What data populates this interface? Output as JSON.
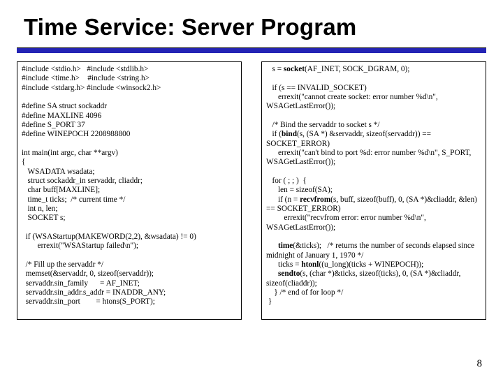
{
  "title": "Time Service: Server Program",
  "page_number": "8",
  "left": {
    "l1": "#include <stdio.h>   #include <stdlib.h>",
    "l2": "#include <time.h>    #include <string.h>",
    "l3": "#include <stdarg.h> #include <winsock2.h>",
    "l4": "",
    "l5": "#define SA struct sockaddr",
    "l6": "#define MAXLINE 4096",
    "l7": "#define S_PORT 37",
    "l8": "#define WINEPOCH 2208988800",
    "l9": "",
    "l10": "int main(int argc, char **argv)",
    "l11": "{",
    "l12": "   WSADATA wsadata;",
    "l13": "   struct sockaddr_in servaddr, cliaddr;",
    "l14": "   char buff[MAXLINE];",
    "l15": "   time_t ticks;  /* current time */",
    "l16": "   int n, len;",
    "l17": "   SOCKET s;",
    "l18": "",
    "l19": "  if (WSAStartup(MAKEWORD(2,2), &wsadata) != 0)",
    "l20": "        errexit(\"WSAStartup failed\\n\");",
    "l21": "",
    "l22": "  /* Fill up the servaddr */",
    "l23": "  memset(&servaddr, 0, sizeof(servaddr));",
    "l24": "  servaddr.sin_family      = AF_INET;",
    "l25": "  servaddr.sin_addr.s_addr = INADDR_ANY;",
    "l26": "  servaddr.sin_port        = htons(S_PORT);"
  },
  "right": {
    "r1a": "   s = ",
    "r1b": "socket",
    "r1c": "(AF_INET, SOCK_DGRAM, 0);",
    "r2": "",
    "r3": "   if (s == INVALID_SOCKET)",
    "r4": "      errexit(\"cannot create socket: error number %d\\n\", WSAGetLastError());",
    "r5": "",
    "r6": "   /* Bind the servaddr to socket s */",
    "r7a": "   if (",
    "r7b": "bind",
    "r7c": "(s, (SA *) &servaddr, sizeof(servaddr)) == SOCKET_ERROR)",
    "r8": "      errexit(\"can't bind to port %d: error number %d\\n\", S_PORT, WSAGetLastError());",
    "r9": "",
    "r10": "   for ( ; ; )  {",
    "r11": "      len = sizeof(SA);",
    "r12a": "      if (n = ",
    "r12b": "recvfrom",
    "r12c": "(s, buff, sizeof(buff), 0, (SA *)&cliaddr, &len) == SOCKET_ERROR)",
    "r13": "         errexit(\"recvfrom error: error number %d\\n\", WSAGetLastError());",
    "r14": "",
    "r15a": "      ",
    "r15b": "time",
    "r15c": "(&ticks);   /* returns the number of seconds elapsed since midnight of January 1, 1970 */",
    "r16a": "      ticks = ",
    "r16b": "htonl",
    "r16c": "((u_long)(ticks + WINEPOCH));",
    "r17a": "      ",
    "r17b": "sendto",
    "r17c": "(s, (char *)&ticks, sizeof(ticks), 0, (SA *)&cliaddr, sizeof(cliaddr));",
    "r18": "    } /* end of for loop */",
    "r19": " }"
  }
}
